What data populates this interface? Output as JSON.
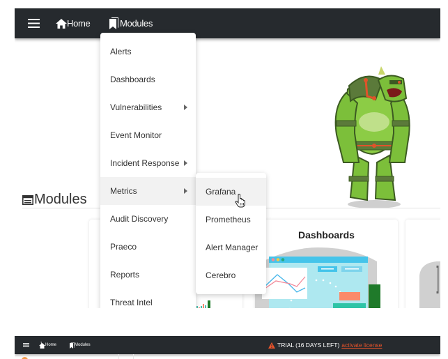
{
  "navbar": {
    "menu_icon": "hamburger-icon",
    "home": {
      "icon": "home-icon",
      "label": "Home"
    },
    "modules": {
      "icon": "bookmark-icon",
      "label": "Modules"
    }
  },
  "modules_menu": {
    "items": [
      {
        "label": "Alerts",
        "has_submenu": false
      },
      {
        "label": "Dashboards",
        "has_submenu": false
      },
      {
        "label": "Vulnerabilities",
        "has_submenu": true
      },
      {
        "label": "Event Monitor",
        "has_submenu": false
      },
      {
        "label": "Incident Response",
        "has_submenu": true
      },
      {
        "label": "Metrics",
        "has_submenu": true,
        "active": true
      },
      {
        "label": "Audit Discovery",
        "has_submenu": false
      },
      {
        "label": "Praeco",
        "has_submenu": false
      },
      {
        "label": "Reports",
        "has_submenu": false
      },
      {
        "label": "Threat Intel",
        "has_submenu": false
      }
    ]
  },
  "metrics_submenu": {
    "items": [
      {
        "label": "Grafana",
        "hovered": true
      },
      {
        "label": "Prometheus"
      },
      {
        "label": "Alert Manager"
      },
      {
        "label": "Cerebro"
      }
    ]
  },
  "page": {
    "section_icon": "window-icon",
    "section_title": "Modules",
    "cards": [
      {
        "title": ""
      },
      {
        "title": "Dashboards"
      },
      {
        "title": ""
      }
    ]
  },
  "bottom_bar": {
    "home_label": "Home",
    "modules_label": "Modules",
    "trial_text": "TRIAL (16 DAYS LEFT)",
    "activate_link": "activate license",
    "warning_color": "#e8532a"
  },
  "colors": {
    "navbar_bg": "#262a2e",
    "menu_hover_bg": "#f2f2f2",
    "accent_warning": "#e8532a"
  }
}
